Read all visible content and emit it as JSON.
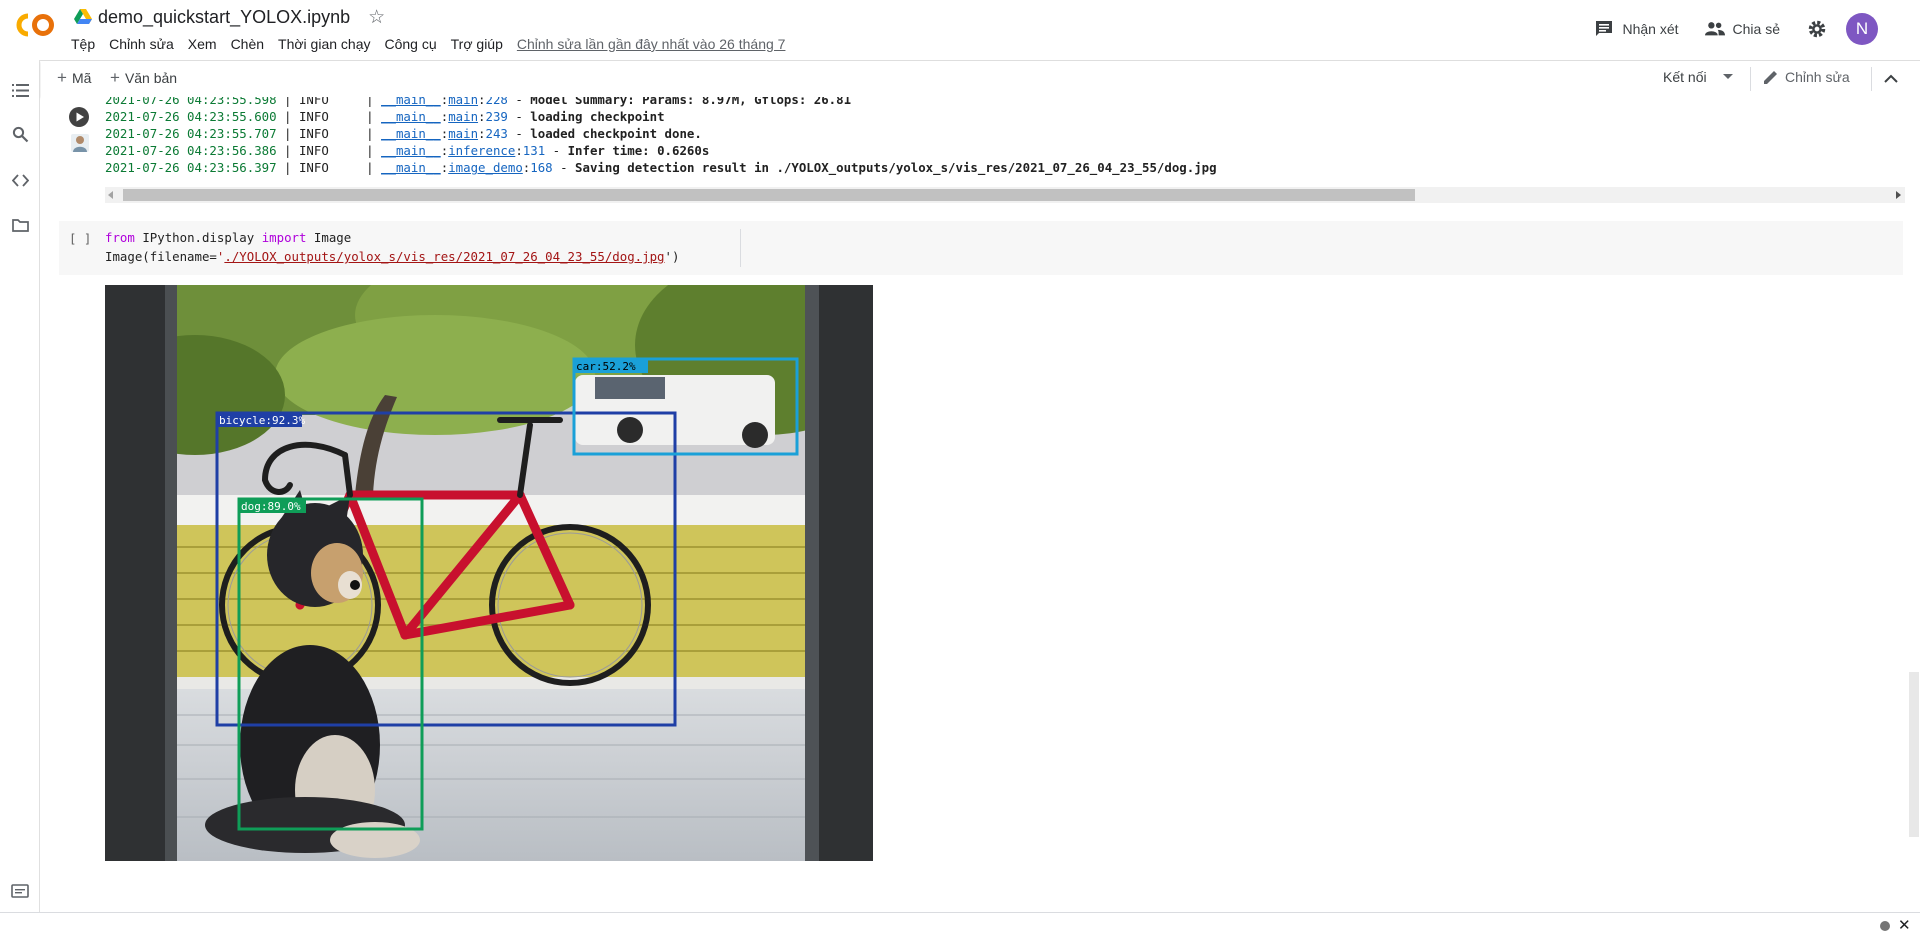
{
  "header": {
    "notebook_title": "demo_quickstart_YOLOX.ipynb",
    "logo_text": "CO",
    "menu": [
      "Tệp",
      "Chỉnh sửa",
      "Xem",
      "Chèn",
      "Thời gian chạy",
      "Công cụ",
      "Trợ giúp"
    ],
    "last_edit": "Chỉnh sửa lần gần đây nhất vào 26 tháng 7",
    "comments_label": "Nhận xét",
    "share_label": "Chia sẻ",
    "avatar_initial": "N",
    "avatar_color": "#7e57c2"
  },
  "toolbar": {
    "add_code_label": "Mã",
    "add_text_label": "Văn bản",
    "connect_label": "Kết nối",
    "edit_label": "Chỉnh sửa"
  },
  "output_log": [
    {
      "ts": "2021-07-26 04:23:55.598",
      "level": "INFO",
      "module": "__main__",
      "func": "main",
      "line": "228",
      "msg": "Model Summary: Params: 8.97M, Gflops: 26.81"
    },
    {
      "ts": "2021-07-26 04:23:55.600",
      "level": "INFO",
      "module": "__main__",
      "func": "main",
      "line": "239",
      "msg": "loading checkpoint"
    },
    {
      "ts": "2021-07-26 04:23:55.707",
      "level": "INFO",
      "module": "__main__",
      "func": "main",
      "line": "243",
      "msg": "loaded checkpoint done."
    },
    {
      "ts": "2021-07-26 04:23:56.386",
      "level": "INFO",
      "module": "__main__",
      "func": "inference",
      "line": "131",
      "msg": "Infer time: 0.6260s"
    },
    {
      "ts": "2021-07-26 04:23:56.397",
      "level": "INFO",
      "module": "__main__",
      "func": "image_demo",
      "line": "168",
      "msg": "Saving detection result in ./YOLOX_outputs/yolox_s/vis_res/2021_07_26_04_23_55/dog.jpg"
    }
  ],
  "code_cell": {
    "bracket": "[ ]",
    "line1": {
      "kw1": "from",
      "mod": "IPython.display",
      "kw2": "import",
      "name": "Image"
    },
    "line2": {
      "prefix": "Image(filename=",
      "quote": "'",
      "path": "./YOLOX_outputs/yolox_s/vis_res/2021_07_26_04_23_55/dog.jpg",
      "suffix": "')"
    }
  },
  "detections": [
    {
      "label": "bicycle:92.3%",
      "color": "#1f3fa6"
    },
    {
      "label": "dog:89.0%",
      "color": "#0f9d58"
    },
    {
      "label": "car:52.2%",
      "color": "#1aa0d8"
    }
  ]
}
